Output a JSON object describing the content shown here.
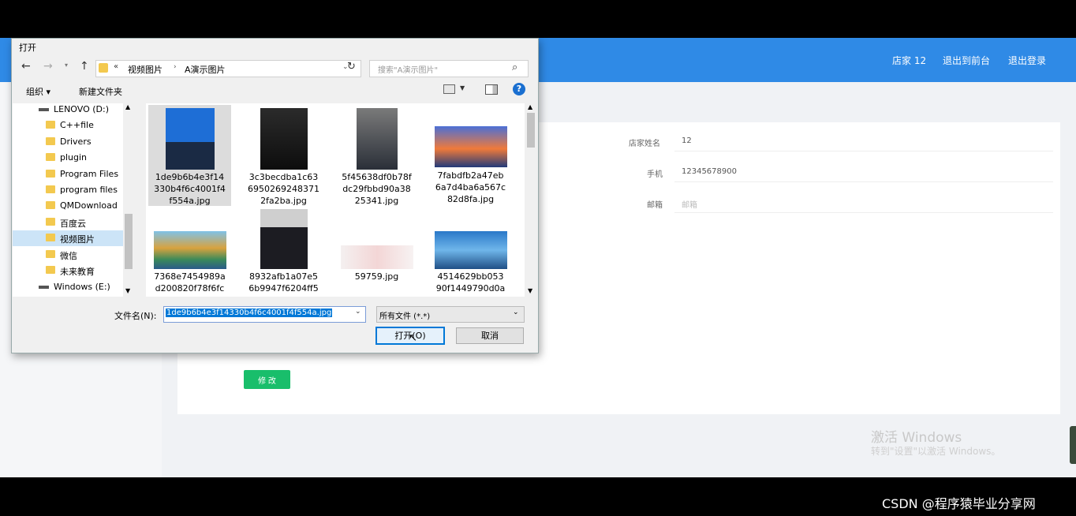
{
  "app": {
    "nav": [
      "店家 12",
      "退出到前台",
      "退出登录"
    ],
    "fields": [
      {
        "label": "店家姓名",
        "value": "12"
      },
      {
        "label": "手机",
        "value": "12345678900"
      },
      {
        "label": "邮箱",
        "value": "邮箱"
      }
    ],
    "edit_label": "修 改",
    "accent": "#2f8ae6",
    "edit_color": "#19be6b"
  },
  "watermark": {
    "line1": "激活 Windows",
    "line2": "转到\"设置\"以激活 Windows。"
  },
  "csdn_credit": "CSDN @程序猿毕业分享网",
  "dialog": {
    "title": "打开",
    "breadcrumb": [
      "视频图片",
      "A演示图片"
    ],
    "breadcrumb_prefix": "«",
    "search_placeholder": "搜索\"A演示图片\"",
    "toolbar": {
      "organize": "组织 ▾",
      "new_folder": "新建文件夹"
    },
    "tree": [
      {
        "label": "LENOVO (D:)",
        "type": "drive"
      },
      {
        "label": "C++file",
        "type": "folder"
      },
      {
        "label": "Drivers",
        "type": "folder"
      },
      {
        "label": "plugin",
        "type": "folder"
      },
      {
        "label": "Program Files",
        "type": "folder"
      },
      {
        "label": "program files",
        "type": "folder"
      },
      {
        "label": "QMDownload",
        "type": "folder"
      },
      {
        "label": "百度云",
        "type": "folder"
      },
      {
        "label": "视频图片",
        "type": "folder",
        "selected": true
      },
      {
        "label": "微信",
        "type": "folder"
      },
      {
        "label": "未来教育",
        "type": "folder"
      },
      {
        "label": "Windows (E:)",
        "type": "drive"
      }
    ],
    "files": [
      {
        "lines": [
          "1de9b6b4e3f14",
          "330b4f6c4001f4",
          "f554a.jpg"
        ],
        "selected": true
      },
      {
        "lines": [
          "3c3becdba1c63",
          "6950269248371",
          "2fa2ba.jpg"
        ]
      },
      {
        "lines": [
          "5f45638df0b78f",
          "dc29fbbd90a38",
          "25341.jpg"
        ]
      },
      {
        "lines": [
          "7fabdfb2a47eb",
          "6a7d4ba6a567c",
          "82d8fa.jpg"
        ]
      },
      {
        "lines": [
          "7368e7454989a",
          "d200820f78f6fc"
        ]
      },
      {
        "lines": [
          "8932afb1a07e5",
          "6b9947f6204ff5"
        ]
      },
      {
        "lines": [
          "59759.jpg"
        ]
      },
      {
        "lines": [
          "4514629bb053",
          "90f1449790d0a"
        ]
      }
    ],
    "filename_label": "文件名(N):",
    "filename_value": "1de9b6b4e3f14330b4f6c4001f4f554a.jpg",
    "filter_value": "所有文件 (*.*)",
    "open_label": "打开(O)",
    "cancel_label": "取消"
  }
}
